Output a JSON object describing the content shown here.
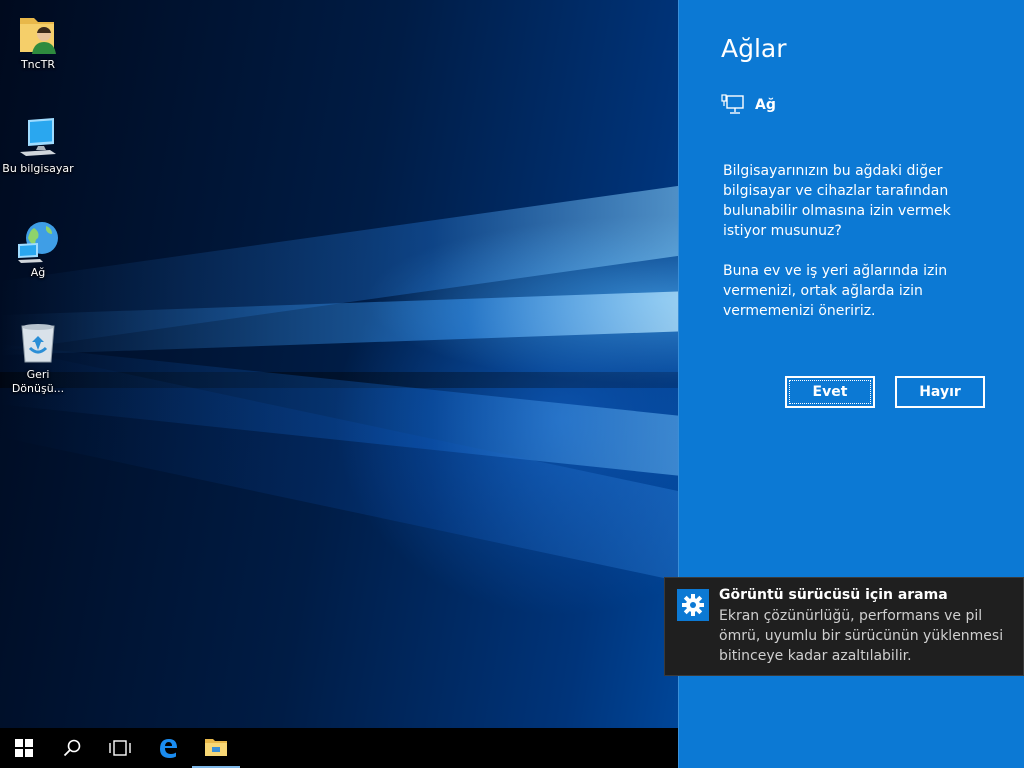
{
  "desktop": {
    "icons": [
      {
        "label": "TncTR",
        "icon": "user-folder-icon"
      },
      {
        "label": "Bu bilgisayar",
        "icon": "computer-icon"
      },
      {
        "label": "Ağ",
        "icon": "network-globe-icon"
      },
      {
        "label": "Geri Dönüşü...",
        "icon": "recycle-bin-icon"
      }
    ]
  },
  "taskbar": {
    "items": [
      "start-icon",
      "search-icon",
      "task-view-icon",
      "edge-icon",
      "file-explorer-icon"
    ]
  },
  "networks_panel": {
    "title": "Ağlar",
    "network_name": "Ağ",
    "prompt_1": "Bilgisayarınızın bu ağdaki diğer bilgisayar ve cihazlar tarafından bulunabilir olmasına izin vermek istiyor musunuz?",
    "prompt_2": "Buna ev ve iş yeri ağlarında izin vermenizi, ortak ağlarda izin vermemenizi öneririz.",
    "yes_label": "Evet",
    "no_label": "Hayır",
    "accent": "#0c79d4"
  },
  "notification": {
    "title": "Görüntü sürücüsü için arama",
    "body": "Ekran çözünürlüğü, performans ve pil ömrü, uyumlu bir sürücünün yüklenmesi bitinceye kadar azaltılabilir.",
    "icon": "gear-icon"
  }
}
